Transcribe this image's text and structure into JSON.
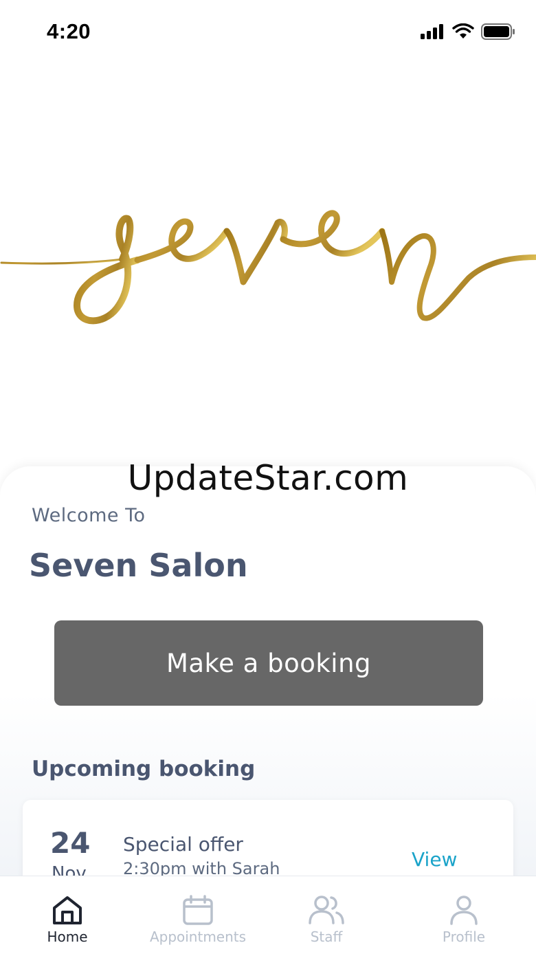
{
  "status_bar": {
    "time": "4:20"
  },
  "brand": {
    "logo_text": "seven",
    "logo_color": "#b8902a"
  },
  "watermark": "UpdateStar.com",
  "welcome": {
    "label": "Welcome To",
    "salon_name": "Seven Salon"
  },
  "cta": {
    "label": "Make a booking"
  },
  "upcoming": {
    "title": "Upcoming booking",
    "booking": {
      "day": "24",
      "month": "Nov",
      "title": "Special offer",
      "subtitle": "2:30pm with Sarah",
      "action": "View"
    }
  },
  "tabs": [
    {
      "label": "Home",
      "icon": "home-icon",
      "active": true
    },
    {
      "label": "Appointments",
      "icon": "calendar-icon",
      "active": false
    },
    {
      "label": "Staff",
      "icon": "staff-icon",
      "active": false
    },
    {
      "label": "Profile",
      "icon": "profile-icon",
      "active": false
    }
  ],
  "colors": {
    "accent": "#1aa3c9",
    "button": "#676767",
    "text": "#4a5670"
  }
}
